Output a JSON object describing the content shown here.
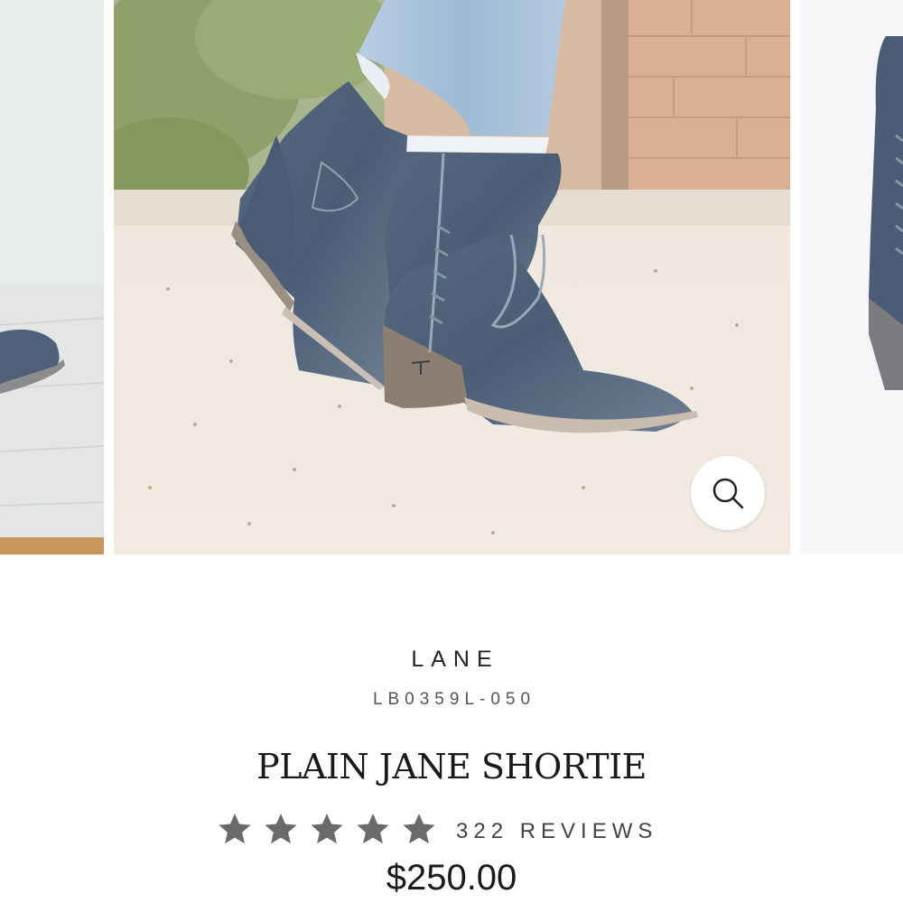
{
  "product": {
    "brand": "LANE",
    "sku": "LB0359L-050",
    "title": "PLAIN JANE SHORTIE",
    "rating": 5,
    "reviews_label": "322 REVIEWS",
    "price": "$250.00"
  },
  "gallery": {
    "zoom_icon": "search-icon"
  },
  "colors": {
    "boot": "#4e6179",
    "denim": "#a9c3dc",
    "star": "#6a6a6a",
    "text": "#1a1a1a"
  }
}
